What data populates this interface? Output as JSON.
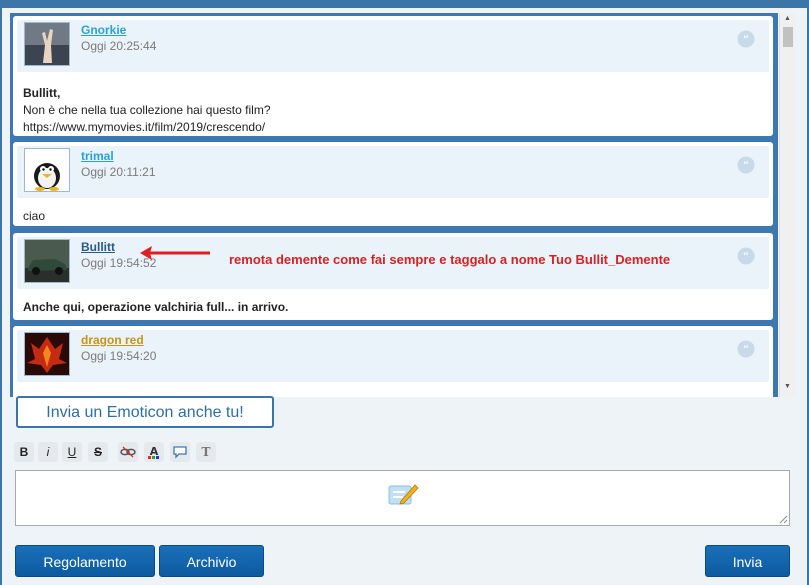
{
  "posts": [
    {
      "username": "Gnorkie",
      "user_color": "#2aa1d9",
      "time": "Oggi 20:25:44",
      "lines": [
        {
          "text": "Bullitt,",
          "bold": true
        },
        {
          "text": "Non è che nella tua collezione hai questo film?",
          "bold": false
        },
        {
          "text": "https://www.mymovies.it/film/2019/crescendo/",
          "bold": false
        }
      ]
    },
    {
      "username": "trimal",
      "user_color": "#2aa1d9",
      "time": "Oggi 20:11:21",
      "lines": [
        {
          "text": "ciao",
          "bold": false
        }
      ]
    },
    {
      "username": "Bullitt",
      "user_color": "#2a5a86",
      "time": "Oggi 19:54:52",
      "lines": [
        {
          "text": "Anche qui, operazione valchiria full... in arrivo.",
          "bold": true
        }
      ]
    },
    {
      "username": "dragon red",
      "user_color": "#c7941b",
      "time": "Oggi 19:54:20",
      "lines": []
    }
  ],
  "annotation": {
    "text": "remota demente come fai sempre e taggalo a nome Tuo Bullit_Demente",
    "color": "#d62222"
  },
  "emoticon_button": "Invia un Emoticon anche tu!",
  "toolbar": {
    "bold": "B",
    "italic": "i",
    "underline": "U",
    "strike": "S",
    "link_icon": "link-icon",
    "color_icon": "text-color-icon",
    "speech_icon": "speech-bubble-icon",
    "font_icon": "T"
  },
  "buttons": {
    "regolamento": "Regolamento",
    "archivio": "Archivio",
    "invia": "Invia"
  },
  "colors": {
    "frame": "#3e75a8",
    "primary_button": "#1a6fb8",
    "header_bg": "#eaf2fa"
  }
}
